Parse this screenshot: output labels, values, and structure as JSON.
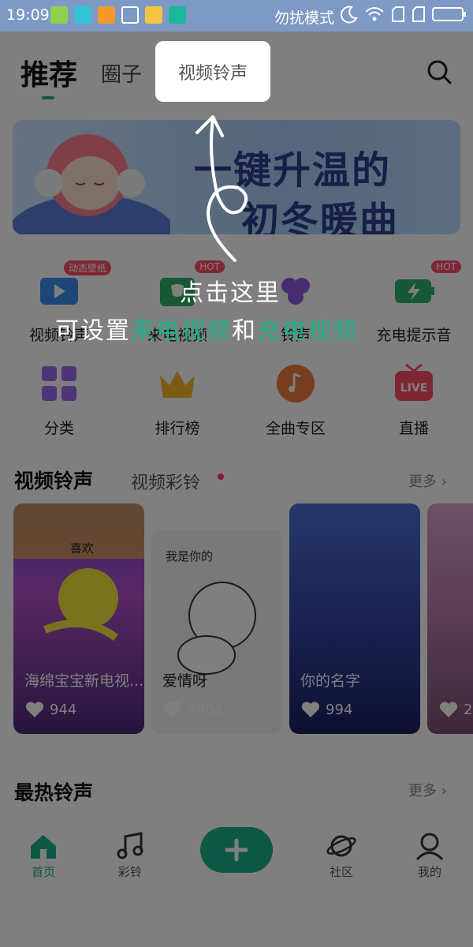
{
  "status_bar": {
    "time": "19:09",
    "dnd_text": "勿扰模式"
  },
  "header": {
    "tabs": [
      {
        "label": "推荐"
      },
      {
        "label": "圈子"
      },
      {
        "label": "视频铃声"
      }
    ]
  },
  "banner": {
    "line1": "一键升温的",
    "line2": "初冬暖曲"
  },
  "feature_row": [
    {
      "label": "视频铃声",
      "badge": "动态壁纸",
      "icon": "video-icon"
    },
    {
      "label": "来电视频",
      "badge": "HOT",
      "icon": "phone-video-icon"
    },
    {
      "label": "铃声",
      "badge": "",
      "icon": "grape-icon"
    },
    {
      "label": "充电提示音",
      "badge": "HOT",
      "icon": "charge-icon"
    }
  ],
  "category_row": [
    {
      "label": "分类",
      "icon": "grid-icon"
    },
    {
      "label": "排行榜",
      "icon": "crown-icon"
    },
    {
      "label": "全曲专区",
      "icon": "music-disc-icon"
    },
    {
      "label": "直播",
      "icon": "live-tv-icon"
    }
  ],
  "video_section": {
    "title": "视频铃声",
    "subtitle": "视频彩铃",
    "more": "更多 ›"
  },
  "video_cards": [
    {
      "title": "海绵宝宝新电视...",
      "likes": "944",
      "overlay_text": "喜欢"
    },
    {
      "title": "爱情呀",
      "likes": "1401",
      "overlay_text": "我是你的"
    },
    {
      "title": "你的名字",
      "likes": "994",
      "overlay_text": ""
    },
    {
      "title": "",
      "likes": "2",
      "overlay_text": ""
    }
  ],
  "hot_section": {
    "title": "最热铃声",
    "more": "更多 ›"
  },
  "bottom_nav": [
    {
      "label": "首页"
    },
    {
      "label": "彩铃"
    },
    {
      "label": "社区"
    },
    {
      "label": "我的"
    }
  ],
  "hint": {
    "line1": "点击这里",
    "line2_pre": "可设置",
    "line2_green1": "来电视频",
    "line2_mid": "和",
    "line2_green2": "充电视频"
  },
  "colors": {
    "accent": "#1db28a",
    "status_bar": "#7f99c5",
    "hot_badge": "#ff4d6a"
  }
}
